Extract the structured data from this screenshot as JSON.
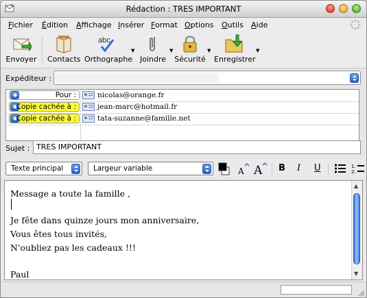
{
  "window": {
    "title": "Rédaction : TRES IMPORTANT"
  },
  "menu": {
    "items": [
      {
        "first": "F",
        "rest": "ichier"
      },
      {
        "first": "É",
        "rest": "dition"
      },
      {
        "first": "A",
        "rest": "ffichage"
      },
      {
        "first": "I",
        "rest": "nsérer"
      },
      {
        "first": "F",
        "rest": "ormat"
      },
      {
        "first": "O",
        "rest": "ptions"
      },
      {
        "first": "O",
        "rest": "utils"
      },
      {
        "first": "A",
        "rest": "ide"
      }
    ]
  },
  "toolbar": {
    "send": "Envoyer",
    "contacts": "Contacts",
    "spelling": "Orthographe",
    "attach": "Joindre",
    "security": "Sécurité",
    "save": "Enregistrer",
    "spelling_icon_text": "abc"
  },
  "header": {
    "sender_label": "Expéditeur :",
    "subject_label": "Sujet :",
    "subject_value": "TRES IMPORTANT",
    "recipients": [
      {
        "type": "Pour :",
        "address": "nicolas@orange.fr",
        "highlight": false
      },
      {
        "type": "Copie cachée à :",
        "address": "jean-marc@hotmail.fr",
        "highlight": true
      },
      {
        "type": "Copie cachée à :",
        "address": "tata-suzanne@famille.net",
        "highlight": true
      }
    ],
    "highlight_color": "#ffff33"
  },
  "format": {
    "paragraph_style": "Texte principal",
    "font": "Largeur variable",
    "bold": "B",
    "italic": "I",
    "underline": "U"
  },
  "message": {
    "lines": [
      "Message a toute la famille ,",
      "",
      "Je fête dans quinze jours mon anniversaire,",
      "Vous êtes tous invités,",
      "N'oubliez pas les cadeaux !!!",
      "",
      "Paul"
    ]
  }
}
